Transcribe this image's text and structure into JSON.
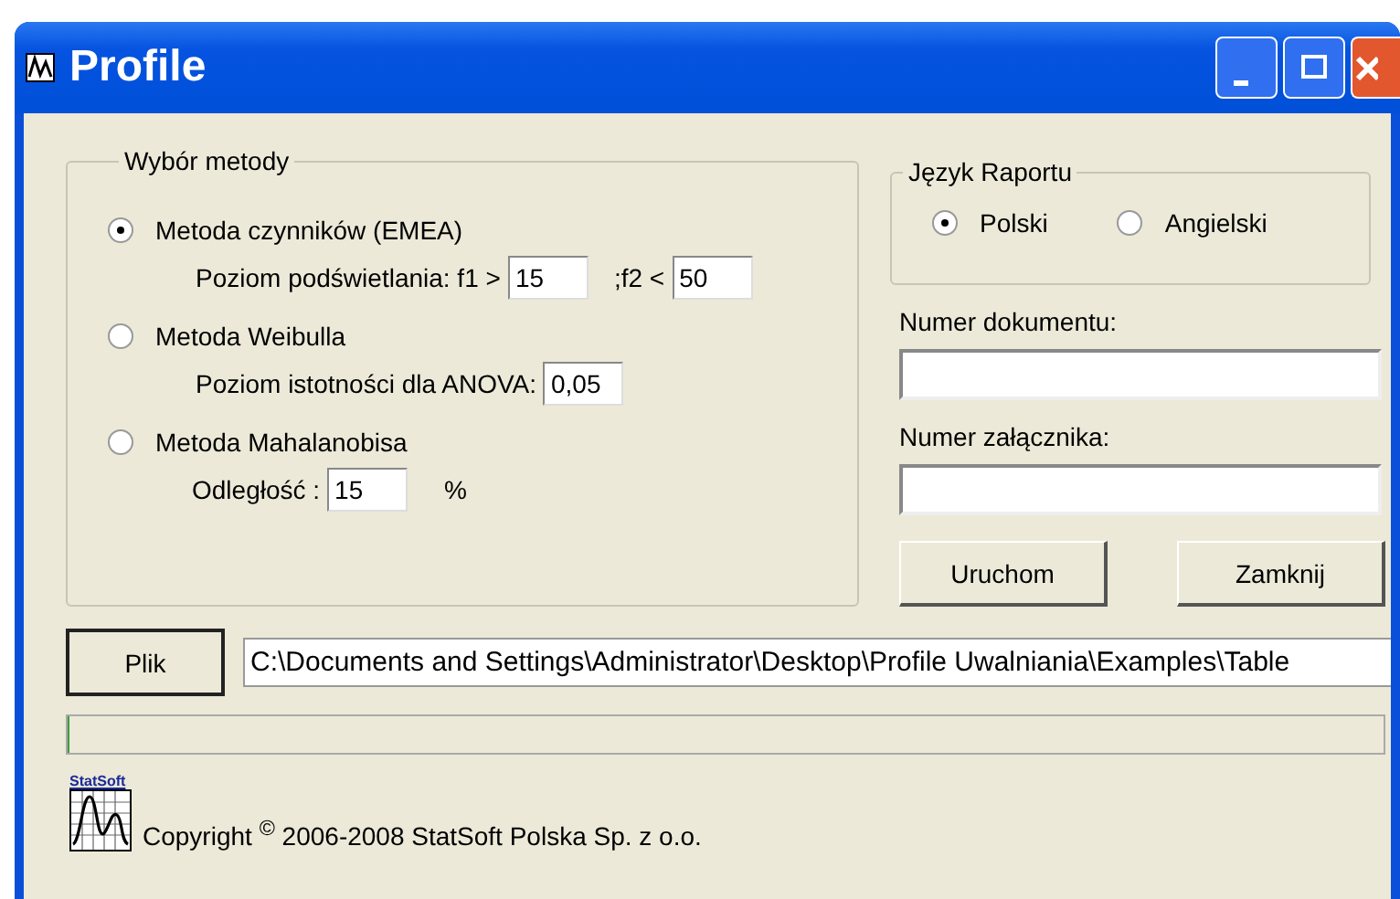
{
  "window": {
    "title": "Profile"
  },
  "method_group": {
    "title": "Wybór metody",
    "options": [
      {
        "label": "Metoda czynników  (EMEA)",
        "selected": true,
        "kind": "thresholds",
        "prefix": "Poziom podświetlania:  f1 >",
        "value1": "15",
        "middle": ";f2 <",
        "value2": "50"
      },
      {
        "label": "Metoda Weibulla",
        "selected": false,
        "kind": "single",
        "prefix": "Poziom istotności dla ANOVA:",
        "value1": "0,05"
      },
      {
        "label": "Metoda Mahalanobisa",
        "selected": false,
        "kind": "percent",
        "prefix": "Odległość :",
        "value1": "15",
        "suffix": "%"
      }
    ]
  },
  "language_group": {
    "title": "Język Raportu",
    "options": [
      {
        "label": "Polski",
        "selected": true
      },
      {
        "label": "Angielski",
        "selected": false
      }
    ]
  },
  "fields": [
    {
      "label": "Numer dokumentu:"
    },
    {
      "label": "Numer załącznika:"
    }
  ],
  "buttons": [
    "Uruchom",
    "Zamknij"
  ],
  "file_button": "Plik",
  "file_path": "C:\\Documents and Settings\\Administrator\\Desktop\\Profile Uwalniania\\Examples\\Table",
  "progress": {
    "level": 0
  },
  "logo_text": "StatSoft",
  "copyright": "Copyright $^{©}$ 2006-2008 StatSoft Polska Sp. z o.o."
}
